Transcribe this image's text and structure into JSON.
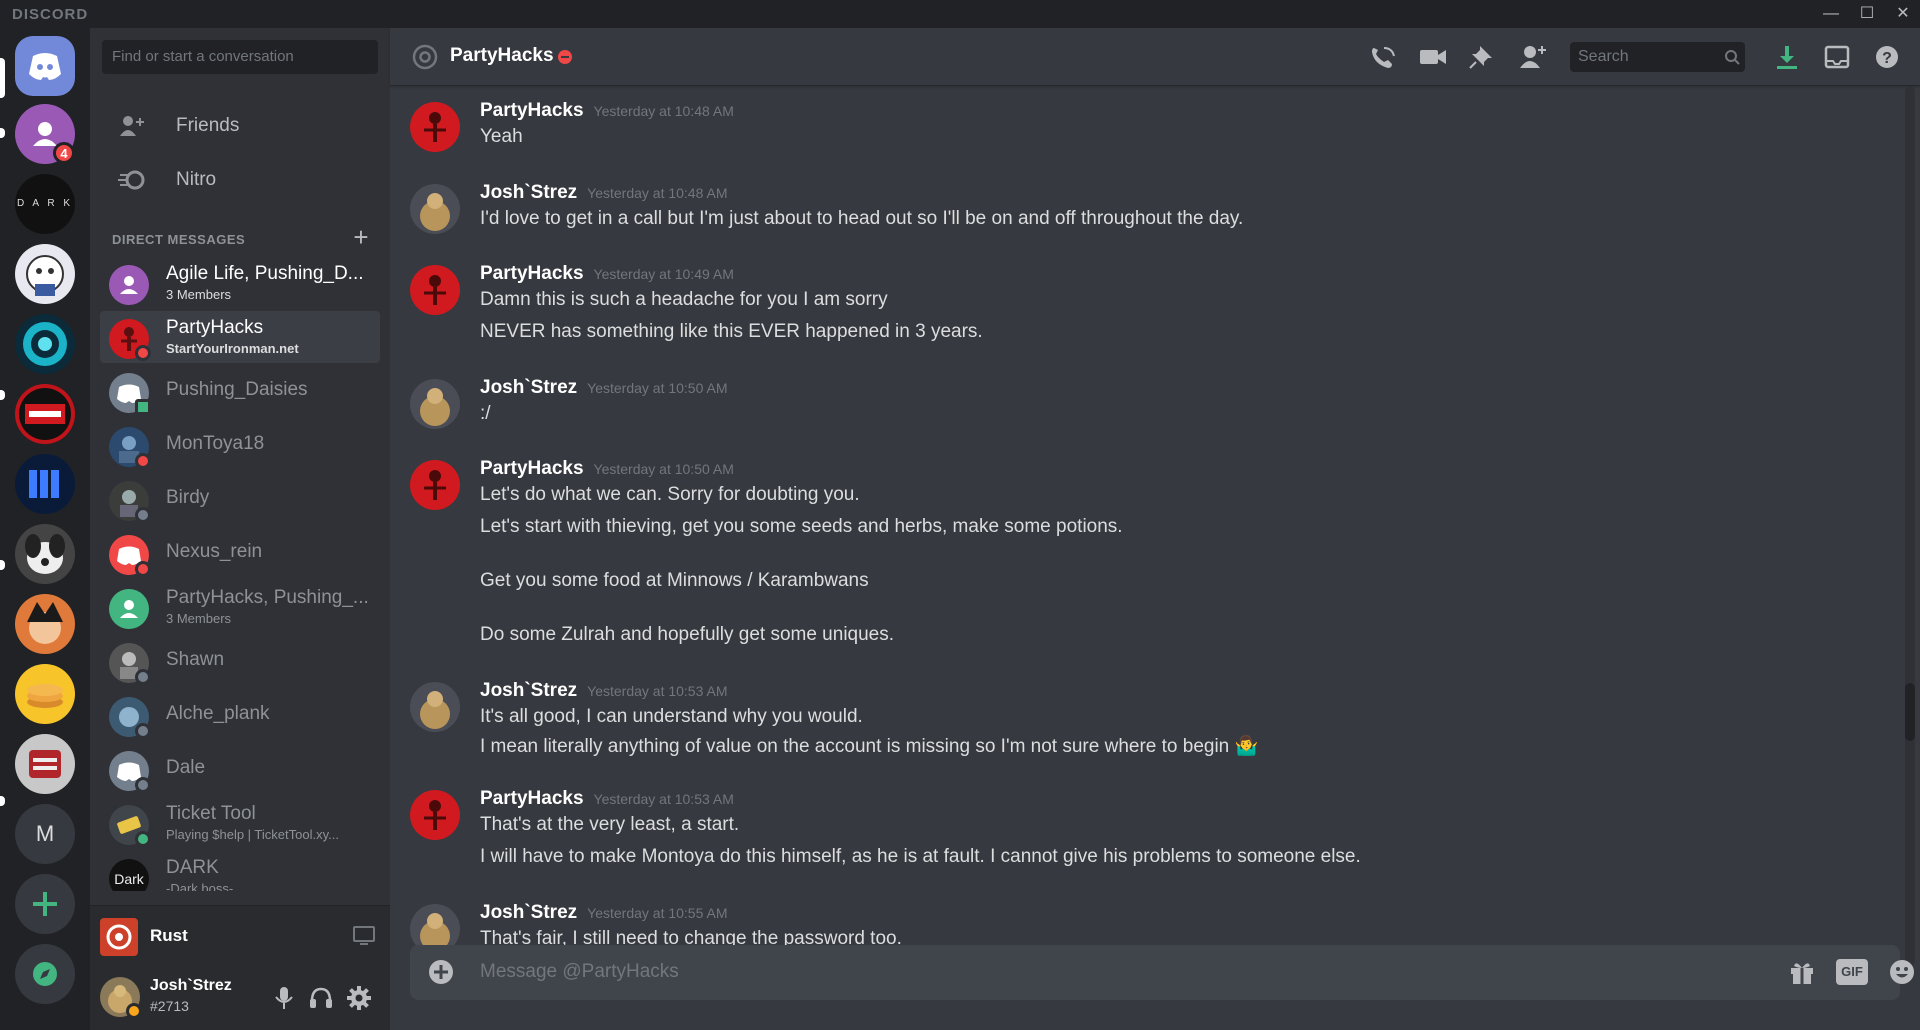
{
  "window": {
    "brand": "DISCORD"
  },
  "rail": {
    "home_badge": "4",
    "m_label": "M",
    "dark_label": "D A R K"
  },
  "sidebar": {
    "search_placeholder": "Find or start a conversation",
    "friends": "Friends",
    "nitro": "Nitro",
    "dm_header": "DIRECT MESSAGES",
    "dms": [
      {
        "name": "Agile Life, Pushing_D...",
        "sub": "3 Members"
      },
      {
        "name": "PartyHacks",
        "sub": "StartYourIronman.net"
      },
      {
        "name": "Pushing_Daisies"
      },
      {
        "name": "MonToya18"
      },
      {
        "name": "Birdy"
      },
      {
        "name": "Nexus_rein"
      },
      {
        "name": "PartyHacks, Pushing_...",
        "sub": "3 Members"
      },
      {
        "name": "Shawn"
      },
      {
        "name": "Alche_plank"
      },
      {
        "name": "Dale"
      },
      {
        "name": "Ticket Tool",
        "sub": "Playing $help | TicketTool.xy..."
      },
      {
        "name": "DARK",
        "sub": "-Dark boss-"
      }
    ],
    "activity": {
      "game": "Rust"
    },
    "user": {
      "name": "Josh`Strez",
      "tag": "#2713"
    }
  },
  "header": {
    "channel": "PartyHacks",
    "search_placeholder": "Search"
  },
  "messages": [
    {
      "author": "PartyHacks",
      "time": "Yesterday at 10:48 AM",
      "lines": [
        "Yeah"
      ]
    },
    {
      "author": "Josh`Strez",
      "time": "Yesterday at 10:48 AM",
      "lines": [
        "I'd love to get in a call but I'm just about to head out so I'll be on and off throughout the day."
      ]
    },
    {
      "author": "PartyHacks",
      "time": "Yesterday at 10:49 AM",
      "lines": [
        "Damn this is such a headache for you I am sorry",
        "NEVER has something like this EVER happened in 3 years."
      ]
    },
    {
      "author": "Josh`Strez",
      "time": "Yesterday at 10:50 AM",
      "lines": [
        ":/"
      ]
    },
    {
      "author": "PartyHacks",
      "time": "Yesterday at 10:50 AM",
      "lines": [
        "Let's do what we can. Sorry for doubting you.",
        "Let's start with thieving, get you some seeds and herbs, make some potions.",
        "Get you some food at Minnows / Karambwans",
        "Do some Zulrah and hopefully get some uniques."
      ]
    },
    {
      "author": "Josh`Strez",
      "time": "Yesterday at 10:53 AM",
      "lines": [
        "It's all good, I can understand why you would.",
        "I mean literally anything of value on the account is missing so I'm not sure where to begin 🤷‍♂️"
      ]
    },
    {
      "author": "PartyHacks",
      "time": "Yesterday at 10:53 AM",
      "lines": [
        "That's at the very least, a start.",
        "I will have to make Montoya do this himself, as he is at fault. I cannot give his problems to someone else."
      ]
    },
    {
      "author": "Josh`Strez",
      "time": "Yesterday at 10:55 AM",
      "lines": [
        "That's fair, I still need to change the password too."
      ]
    }
  ],
  "composer": {
    "placeholder": "Message @PartyHacks",
    "gif": "GIF"
  },
  "colors": {
    "blurple": "#7289da",
    "dnd": "#f04747",
    "online": "#43b581",
    "idle": "#faa61a"
  }
}
